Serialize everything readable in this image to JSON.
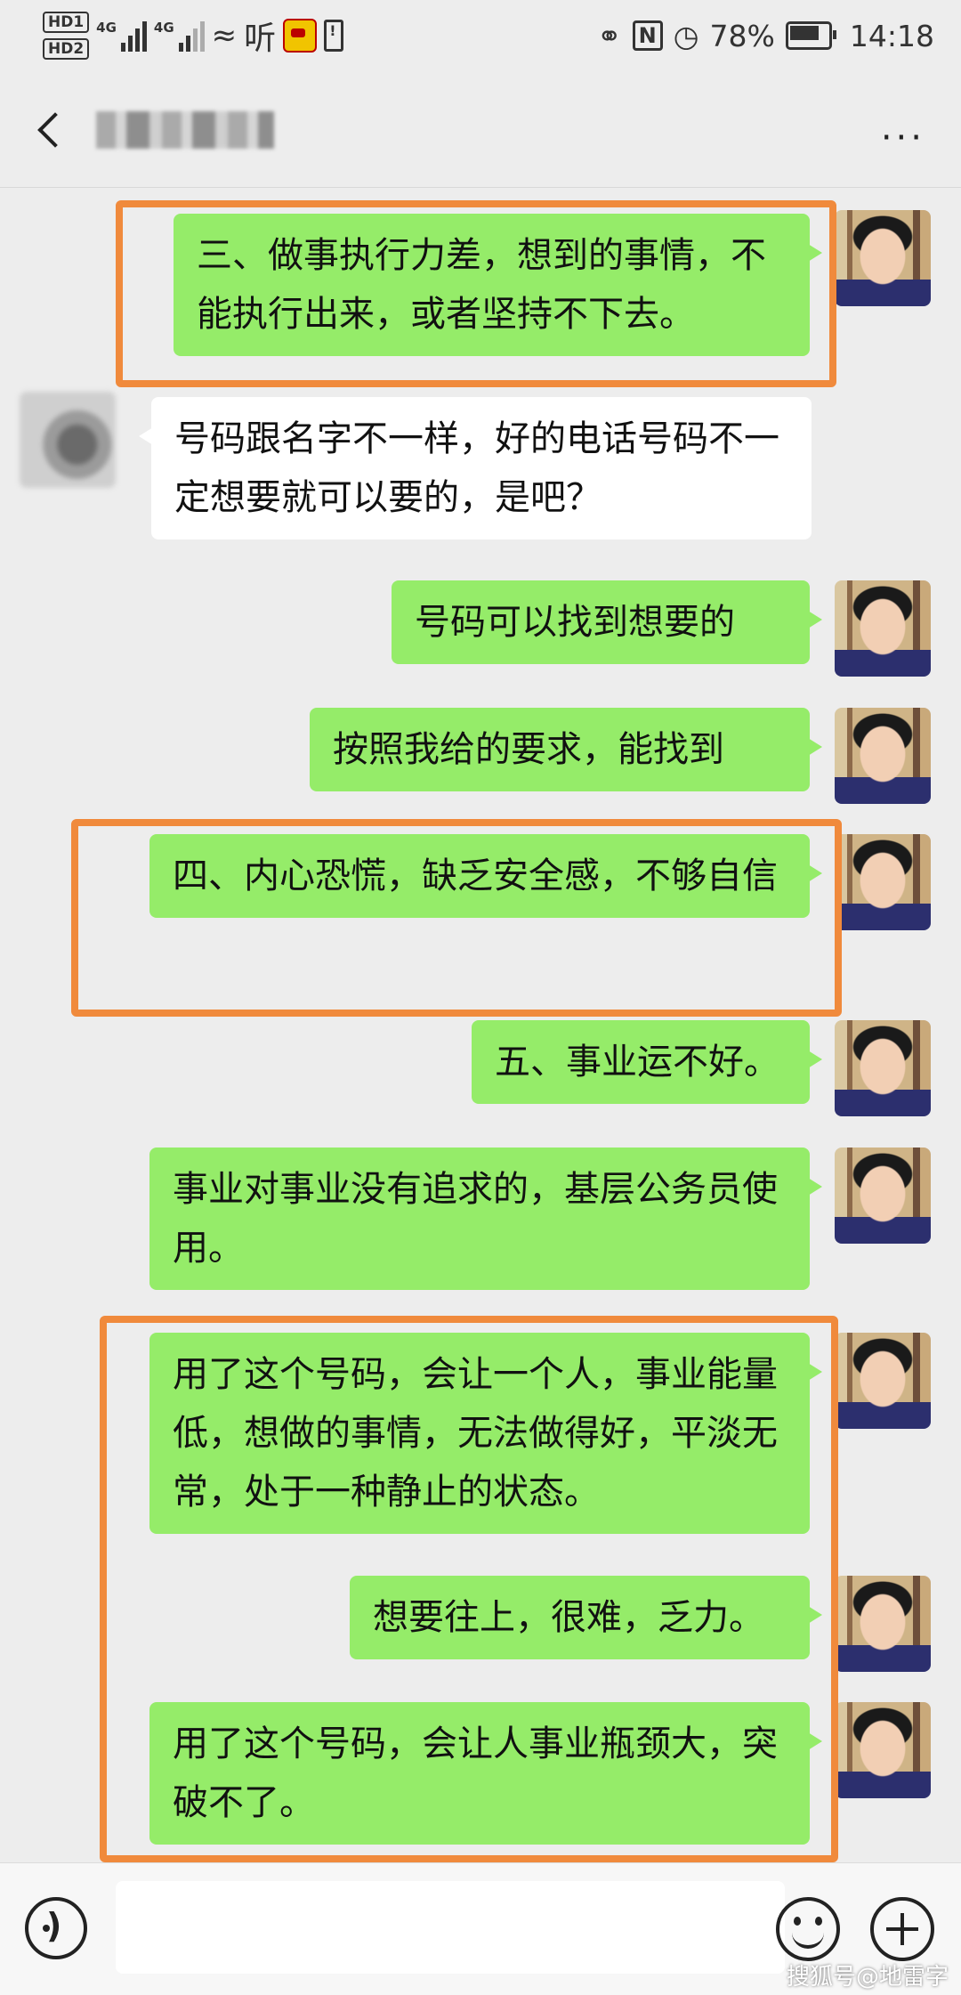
{
  "status_bar": {
    "hd1": "HD1",
    "hd2": "HD2",
    "net1": "4G",
    "net2": "4G",
    "ting": "听",
    "battery": "78%",
    "time": "14:18"
  },
  "header": {
    "contact_name": "▒▒▒▒▒"
  },
  "messages": [
    {
      "side": "out",
      "text": "三、做事执行力差，想到的事情，不能执行出来，或者坚持不下去。"
    },
    {
      "side": "in",
      "text": "号码跟名字不一样，好的电话号码不一定想要就可以要的，是吧？"
    },
    {
      "side": "out",
      "text": "号码可以找到想要的"
    },
    {
      "side": "out",
      "text": "按照我给的要求，能找到"
    },
    {
      "side": "out",
      "text": "四、内心恐慌，缺乏安全感，不够自信"
    },
    {
      "side": "out",
      "text": "五、事业运不好。"
    },
    {
      "side": "out",
      "text": "事业对事业没有追求的，基层公务员使用。"
    },
    {
      "side": "out",
      "text": "用了这个号码，会让一个人，事业能量低，想做的事情，无法做得好，平淡无常，处于一种静止的状态。"
    },
    {
      "side": "out",
      "text": "想要往上，很难，乏力。"
    },
    {
      "side": "out",
      "text": "用了这个号码，会让人事业瓶颈大，突破不了。"
    }
  ],
  "watermark": "搜狐号@地雷字",
  "colors": {
    "bubble_out": "#95ec69",
    "bubble_in": "#ffffff",
    "highlight": "#f08a3c",
    "background": "#ededed"
  }
}
